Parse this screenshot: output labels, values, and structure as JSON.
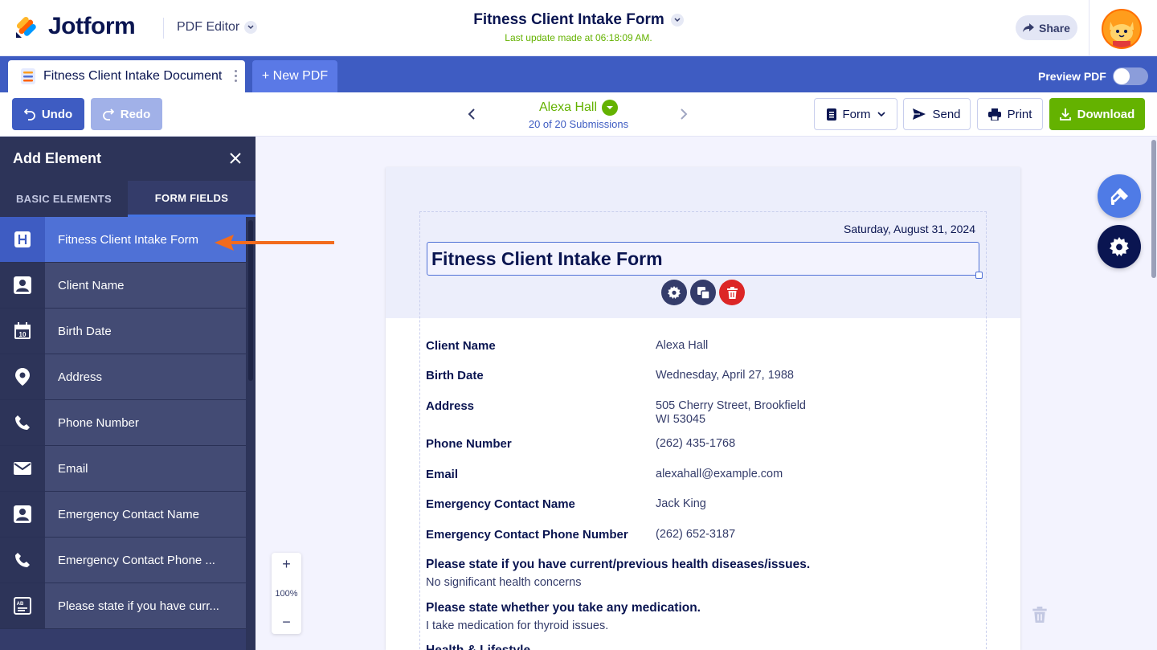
{
  "header": {
    "logo_text": "Jotform",
    "app_name": "PDF Editor",
    "doc_title": "Fitness Client Intake Form",
    "last_update": "Last update made at 06:18:09 AM.",
    "share_label": "Share"
  },
  "tabs": {
    "doc_tab_label": "Fitness Client Intake Document",
    "new_pdf_label": "+ New PDF",
    "preview_label": "Preview PDF",
    "preview_on": false
  },
  "toolbar": {
    "undo_label": "Undo",
    "redo_label": "Redo",
    "submitter_name": "Alexa Hall",
    "submission_count": "20 of 20 Submissions",
    "form_label": "Form",
    "send_label": "Send",
    "print_label": "Print",
    "download_label": "Download"
  },
  "sidebar": {
    "title": "Add Element",
    "tabs": [
      "BASIC ELEMENTS",
      "FORM FIELDS"
    ],
    "active_tab": "FORM FIELDS",
    "items": [
      {
        "label": "Fitness Client Intake Form",
        "icon": "heading-icon",
        "active": true
      },
      {
        "label": "Client Name",
        "icon": "person-icon"
      },
      {
        "label": "Birth Date",
        "icon": "calendar-icon"
      },
      {
        "label": "Address",
        "icon": "location-pin-icon"
      },
      {
        "label": "Phone Number",
        "icon": "phone-icon"
      },
      {
        "label": "Email",
        "icon": "envelope-icon"
      },
      {
        "label": "Emergency Contact Name",
        "icon": "person-icon"
      },
      {
        "label": "Emergency Contact Phone ...",
        "icon": "phone-icon"
      },
      {
        "label": "Please state if you have curr...",
        "icon": "textbox-icon"
      }
    ]
  },
  "zoom": {
    "plus": "+",
    "value": "100%",
    "minus": "−"
  },
  "document": {
    "date": "Saturday, August 31, 2024",
    "title": "Fitness Client Intake Form",
    "fields": [
      {
        "label": "Client Name",
        "value": "Alexa Hall"
      },
      {
        "label": "Birth Date",
        "value": "Wednesday, April 27, 1988"
      },
      {
        "label": "Address",
        "value_line1": "505 Cherry Street, Brookfield",
        "value_line2": "WI 53045"
      },
      {
        "label": "Phone Number",
        "value": "(262) 435-1768"
      },
      {
        "label": "Email",
        "value": "alexahall@example.com"
      },
      {
        "label": "Emergency Contact Name",
        "value": "Jack King"
      },
      {
        "label": "Emergency Contact Phone Number",
        "value": "(262) 652-3187"
      }
    ],
    "questions": [
      {
        "label": "Please state if you have current/previous health diseases/issues.",
        "value": "No significant health concerns"
      },
      {
        "label": "Please state whether you take any medication.",
        "value": "I take medication for thyroid issues."
      },
      {
        "label": "Health & Lifestyle"
      }
    ]
  },
  "colors": {
    "brand_blue": "#3e5cc2",
    "sidebar_bg": "#343c6a",
    "success_green": "#64b200",
    "delete_red": "#dc2626",
    "annotation_orange": "#f26b1d"
  }
}
